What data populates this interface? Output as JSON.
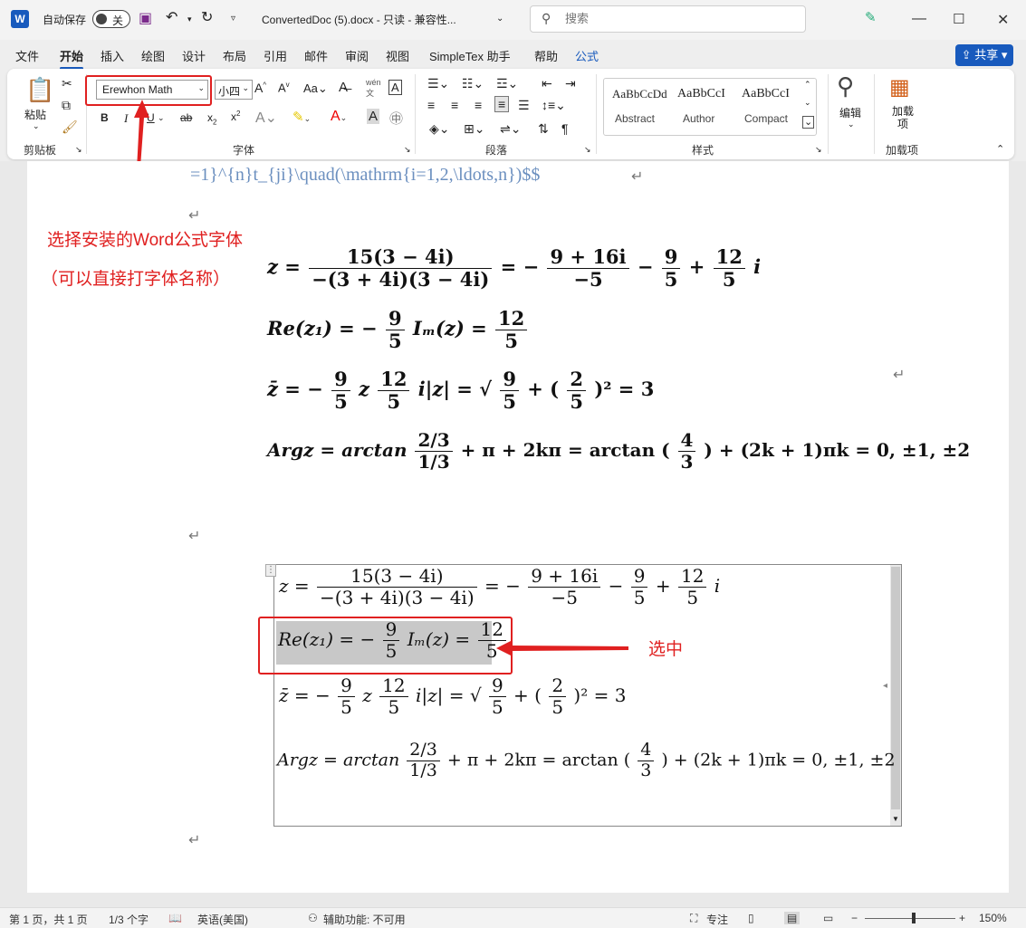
{
  "titlebar": {
    "autosave_label": "自动保存",
    "autosave_state": "关",
    "doc_title": "ConvertedDoc (5).docx  -  只读  -  兼容性...",
    "search_placeholder": "搜索"
  },
  "tabs": [
    "文件",
    "开始",
    "插入",
    "绘图",
    "设计",
    "布局",
    "引用",
    "邮件",
    "审阅",
    "视图",
    "SimpleTex 助手",
    "帮助",
    "公式"
  ],
  "share_label": "共享",
  "ribbon": {
    "clipboard": {
      "paste": "粘贴",
      "group": "剪贴板"
    },
    "font": {
      "name": "Erewhon Math",
      "size": "小四",
      "group": "字体",
      "bold": "B",
      "italic": "I",
      "underline": "U",
      "strike": "ab"
    },
    "paragraph": {
      "group": "段落"
    },
    "styles": {
      "group": "样式",
      "items": [
        {
          "preview": "AaBbCcDd",
          "name": "Abstract"
        },
        {
          "preview": "AaBbCcI",
          "name": "Author"
        },
        {
          "preview": "AaBbCcI",
          "name": "Compact"
        }
      ]
    },
    "editing": {
      "label": "编辑"
    },
    "addins": {
      "label": "加载项",
      "button": "加载项"
    }
  },
  "document": {
    "latex_line": "=1}^{n}t_{ji}\\quad(\\mathrm{i=1,2,\\ldots,n})$$",
    "annotation_1": "选择安装的Word公式字体",
    "annotation_2": "（可以直接打字体名称）",
    "annotation_3": "选中",
    "eq_z": {
      "lhs": "z =",
      "n1": "15(3 − 4i)",
      "d1": "−(3 + 4i)(3 − 4i)",
      "mid": "= −",
      "n2": "9 + 16i",
      "d2": "−5",
      "op1": "−",
      "n3": "9",
      "d3": "5",
      "op2": "+",
      "n4": "12",
      "d4": "5",
      "tail": "i"
    },
    "eq_re": {
      "lhs": "Re(z₁) = −",
      "n1": "9",
      "d1": "5",
      "mid": "Iₘ(z) =",
      "n2": "12",
      "d2": "5"
    },
    "eq_zbar": {
      "lhs": "z̄ = −",
      "n1": "9",
      "d1": "5",
      "mid": "z",
      "n2": "12",
      "d2": "5",
      "mid2": "i|z| = √",
      "n3": "9",
      "d3": "5",
      "plus": "+ (",
      "n4": "2",
      "d4": "5",
      "tail": ")² = 3"
    },
    "eq_arg": {
      "lhs": "Argz = arctan",
      "n1": "2/3",
      "d1": "1/3",
      "mid": "+ π + 2kπ = arctan (",
      "n2": "4",
      "d2": "3",
      "tail": ") + (2k + 1)πk = 0, ±1, ±2"
    }
  },
  "statusbar": {
    "page": "第 1 页，共 1 页",
    "words": "1/3 个字",
    "language": "英语(美国)",
    "accessibility": "辅助功能: 不可用",
    "focus": "专注",
    "zoom": "150%"
  }
}
